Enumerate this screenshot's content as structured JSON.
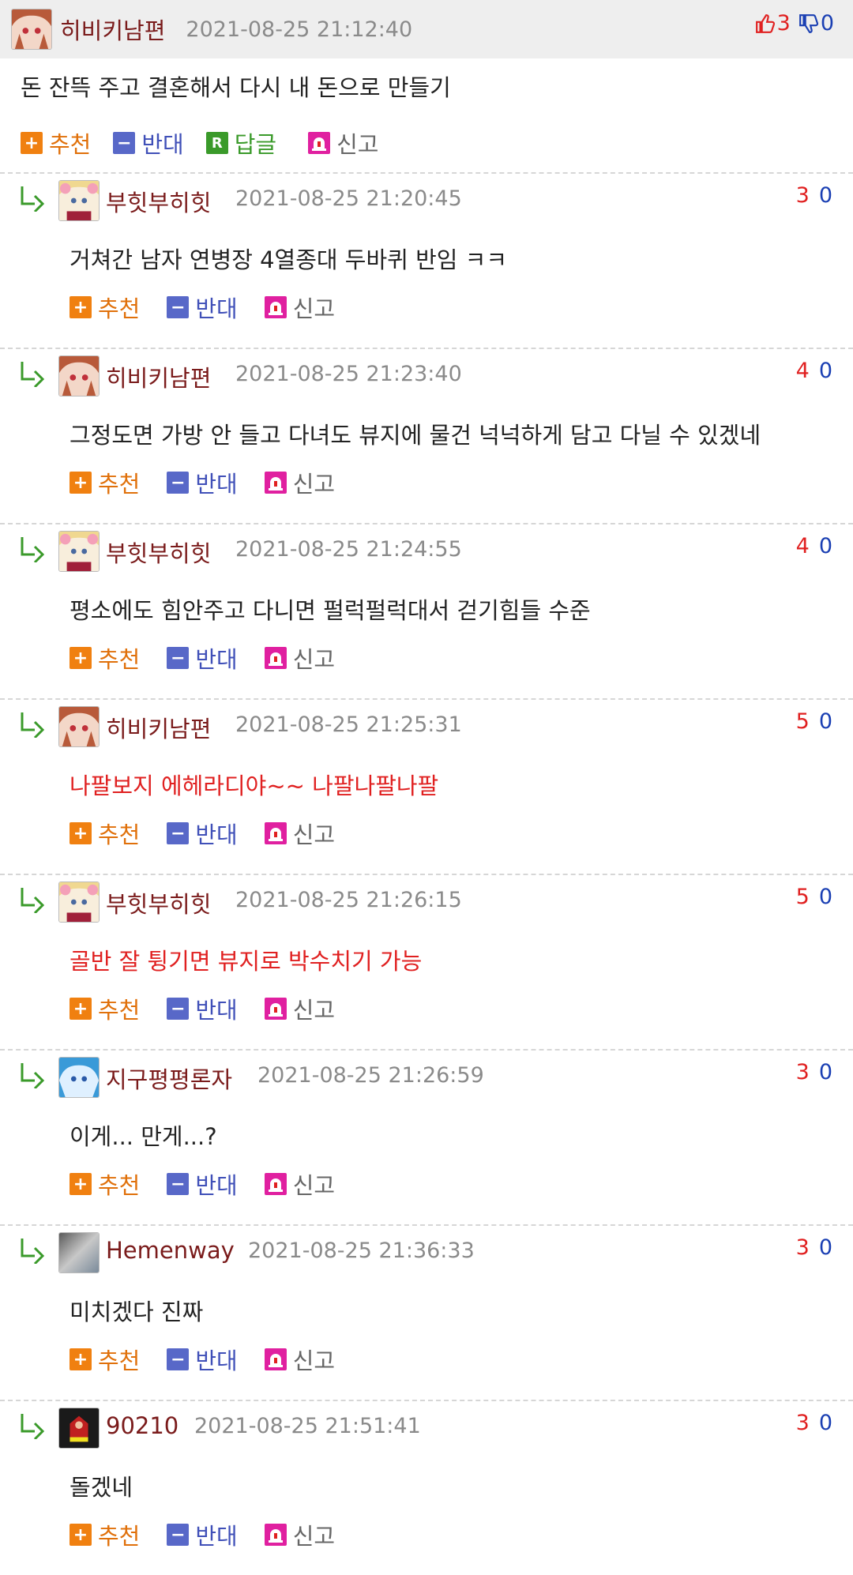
{
  "top": {
    "avatar": "anime-girl-avatar",
    "nickname": "히비키남편",
    "time": "2021-08-25 21:12:40",
    "up": "3",
    "down": "0",
    "body": "돈 잔뜩 주고 결혼해서 다시 내 돈으로 만들기",
    "actions": {
      "recommend": "추천",
      "oppose": "반대",
      "reply": "답글",
      "report": "신고",
      "reply_badge": "R"
    }
  },
  "replies": [
    {
      "nickname": "부힛부히힛",
      "time": "2021-08-25 21:20:45",
      "up": "3",
      "down": "0",
      "body": "거쳐간 남자 연병장 4열종대 두바퀴 반임 ㅋㅋ"
    },
    {
      "nickname": "히비키남편",
      "time": "2021-08-25 21:23:40",
      "up": "4",
      "down": "0",
      "body": "그정도면 가방 안 들고 다녀도 뷰지에 물건 넉넉하게 담고 다닐 수 있겠네"
    },
    {
      "nickname": "부힛부히힛",
      "time": "2021-08-25 21:24:55",
      "up": "4",
      "down": "0",
      "body": "평소에도 힘안주고 다니면 펄럭펄럭대서 걷기힘들 수준"
    },
    {
      "nickname": "히비키남편",
      "time": "2021-08-25 21:25:31",
      "up": "5",
      "down": "0",
      "body": "나팔보지 에헤라디야~~ 나팔나팔나팔"
    },
    {
      "nickname": "부힛부히힛",
      "time": "2021-08-25 21:26:15",
      "up": "5",
      "down": "0",
      "body": "골반 잘 튕기면 뷰지로 박수치기 가능"
    },
    {
      "nickname": "지구평평론자",
      "time": "2021-08-25 21:26:59",
      "up": "3",
      "down": "0",
      "body": "이게... 만게...?"
    },
    {
      "nickname": "Hemenway",
      "time": "2021-08-25 21:36:33",
      "up": "3",
      "down": "0",
      "body": "미치겠다 진짜"
    },
    {
      "nickname": "90210",
      "time": "2021-08-25 21:51:41",
      "up": "3",
      "down": "0",
      "body": "돌겠네"
    }
  ],
  "labels": {
    "recommend": "추천",
    "oppose": "반대",
    "report": "신고",
    "plus": "+",
    "minus": "−"
  },
  "colors": {
    "accent_orange": "#f08010",
    "nick_red": "#7a1b1b",
    "up_red": "#e02020",
    "down_blue": "#1a3fb3",
    "reply_green": "#3a9a2a"
  }
}
